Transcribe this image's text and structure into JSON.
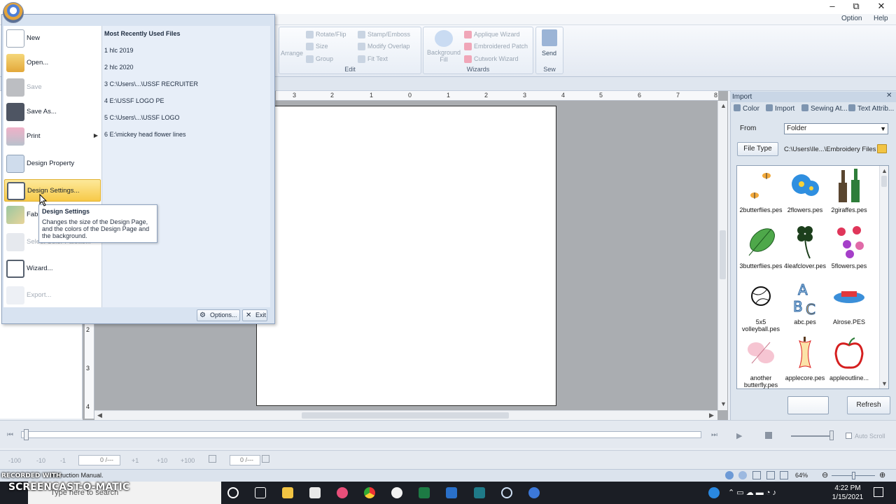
{
  "window": {
    "minimize": "–",
    "maximize": "⧉",
    "close": "✕"
  },
  "menubar": {
    "option": "Option",
    "help": "Help"
  },
  "ribbon": {
    "arrange": "Arrange",
    "rotate_flip": "Rotate/Flip",
    "size": "Size",
    "group": "Group",
    "stamp_emboss": "Stamp/Emboss",
    "modify_overlap": "Modify Overlap",
    "fit_text": "Fit Text",
    "edit_label": "Edit",
    "background_fill": "Background Fill",
    "applique_wizard": "Applique Wizard",
    "embroidered_patch": "Embroidered Patch",
    "cutwork_wizard": "Cutwork Wizard",
    "wizards_label": "Wizards",
    "send": "Send",
    "sew_label": "Sew"
  },
  "ruler": {
    "h_ticks": [
      "3",
      "2",
      "1",
      "0",
      "1",
      "2",
      "3",
      "4",
      "5",
      "6",
      "7",
      "8"
    ],
    "v_ticks": [
      "2",
      "3",
      "4"
    ]
  },
  "app_menu": {
    "items": [
      {
        "label": "New",
        "icon": "new-document-icon"
      },
      {
        "label": "Open...",
        "icon": "open-folder-icon"
      },
      {
        "label": "Save",
        "icon": "save-icon"
      },
      {
        "label": "Save As...",
        "icon": "save-as-icon"
      },
      {
        "label": "Print",
        "icon": "printer-icon"
      },
      {
        "label": "Design Property",
        "icon": "design-property-icon"
      },
      {
        "label": "Design Settings...",
        "icon": "design-settings-icon"
      },
      {
        "label": "Fab",
        "icon": "fabric-icon"
      },
      {
        "label": "Select Color Palette...",
        "icon": "color-palette-icon"
      },
      {
        "label": "Wizard...",
        "icon": "wizard-icon"
      },
      {
        "label": "Export...",
        "icon": "export-icon"
      }
    ],
    "mru_title": "Most Recently Used Files",
    "mru_files": [
      "1 hlc 2019",
      "2 hlc 2020",
      "3 C:\\Users\\...\\USSF RECRUITER",
      "4 E:\\USSF LOGO PE",
      "5 C:\\Users\\...\\USSF LOGO",
      "6 E:\\mickey head flower lines"
    ],
    "options_button": "Options...",
    "exit_button": "Exit"
  },
  "tooltip": {
    "title": "Design Settings",
    "body": "Changes the size of the Design Page, and the colors of the Design Page and the background."
  },
  "import_panel": {
    "title": "Import",
    "tabs": [
      "Color",
      "Import",
      "Sewing At...",
      "Text Attrib..."
    ],
    "from_label": "From",
    "from_value": "Folder",
    "file_type_button": "File Type",
    "file_type_path": "C:\\Users\\Ile...\\Embroidery Files",
    "files": [
      "2butterflies.pes",
      "2flowers.pes",
      "2giraffes.pes",
      "3butterflies.pes",
      "4leafclover.pes",
      "5flowers.pes",
      "5x5 volleyball.pes",
      "abc.pes",
      "Alrose.PES",
      "another butterfly.pes",
      "applecore.pes",
      "appleoutline..."
    ],
    "refresh_button": "Refresh"
  },
  "playback": {
    "auto_scroll": "Auto Scroll"
  },
  "stitch_bar": {
    "minus100": "-100",
    "minus10": "-10",
    "minus1": "-1",
    "counter1": "0 /---",
    "plus1": "+1",
    "plus10": "+10",
    "plus100": "+100",
    "counter2": "0 /---"
  },
  "status": {
    "text": "instruction Manual.",
    "zoom": "64%"
  },
  "watermark": {
    "small": "RECORDED WITH",
    "big": "SCREENCAST-O-MATIC"
  },
  "taskbar": {
    "search_placeholder": "Type here to search",
    "time": "4:22 PM",
    "date": "1/15/2021"
  },
  "colors": {
    "menu_highlight": "#f7c948",
    "canvas_bg": "#aaadb1",
    "ribbon_bg": "#e3e9f2"
  }
}
